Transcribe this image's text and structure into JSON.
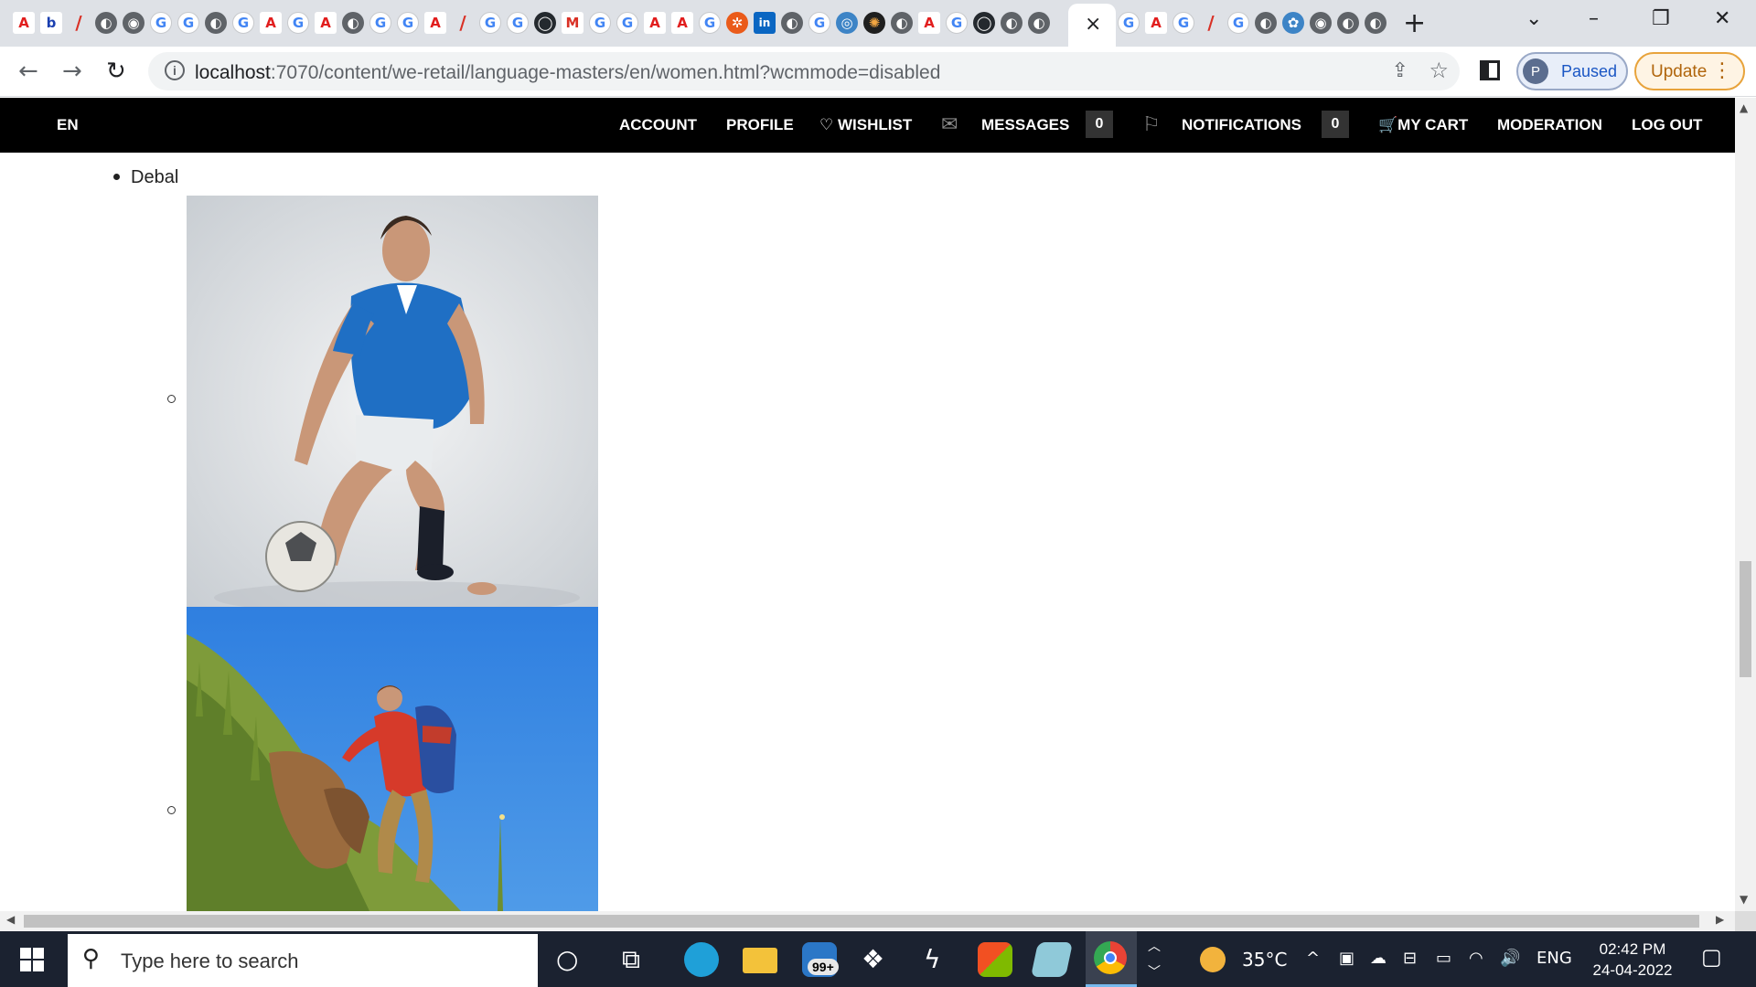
{
  "browser": {
    "tab_close_glyph": "×",
    "new_tab_glyph": "+",
    "address": {
      "host": "localhost",
      "rest": ":7070/content/we-retail/language-masters/en/women.html?wcmmode=disabled"
    },
    "profile": {
      "initial": "P",
      "label": "Paused"
    },
    "update_label": "Update"
  },
  "site_nav": {
    "language": "EN",
    "items": {
      "account": "ACCOUNT",
      "profile": "PROFILE",
      "wishlist": "WISHLIST",
      "messages": "MESSAGES",
      "messages_count": "0",
      "notifications": "NOTIFICATIONS",
      "notifications_count": "0",
      "my_cart": "MY CART",
      "moderation": "MODERATION",
      "log_out": "LOG OUT"
    }
  },
  "content": {
    "list_item": "Debal"
  },
  "taskbar": {
    "search_placeholder": "Type here to search",
    "mail_badge": "99+",
    "weather": "35°C",
    "language": "ENG",
    "time": "02:42 PM",
    "date": "24-04-2022"
  },
  "colors": {
    "nav_background": "#000000",
    "taskbar_background": "#1b2230",
    "sky_blue": "#2f7fe0"
  }
}
